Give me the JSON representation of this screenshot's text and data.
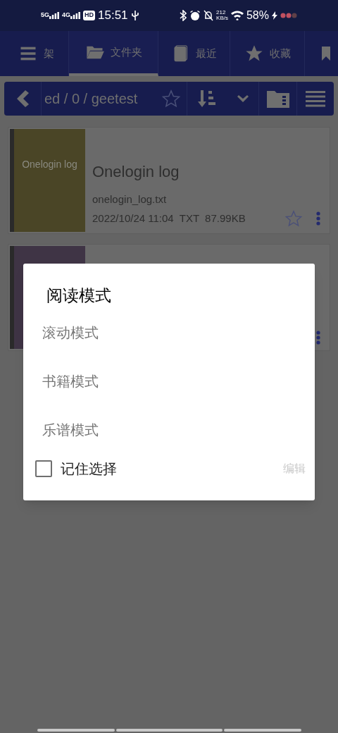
{
  "status_bar": {
    "network_1": "5G",
    "network_2": "4G",
    "hd": "HD",
    "time": "15:51",
    "speed_value": "212",
    "speed_unit": "KB/s",
    "battery": "58%"
  },
  "tabs": [
    {
      "label": "架",
      "kind": "menu",
      "selected": false
    },
    {
      "label": "文件夹",
      "kind": "folder",
      "selected": true
    },
    {
      "label": "最近",
      "kind": "book",
      "selected": false
    },
    {
      "label": "收藏",
      "kind": "star",
      "selected": false
    },
    {
      "kind": "bookmark",
      "selected": false
    }
  ],
  "path_bar": {
    "path": "ed / 0 / geetest",
    "favorite": false
  },
  "files": [
    {
      "cover_title": "Onelogin log",
      "color": "#4a4526",
      "title": "Onelogin log",
      "filename": "onelogin_log.txt",
      "meta": "2022/10/24 11:04  TXT  87.99KB",
      "favorite": false
    },
    {
      "color": "#3f3445"
    }
  ],
  "dialog": {
    "title": "阅读模式",
    "options": [
      "滚动模式",
      "书籍模式",
      "乐谱模式"
    ],
    "remember": {
      "label": "记住选择",
      "checked": false
    },
    "edit": "编辑"
  }
}
